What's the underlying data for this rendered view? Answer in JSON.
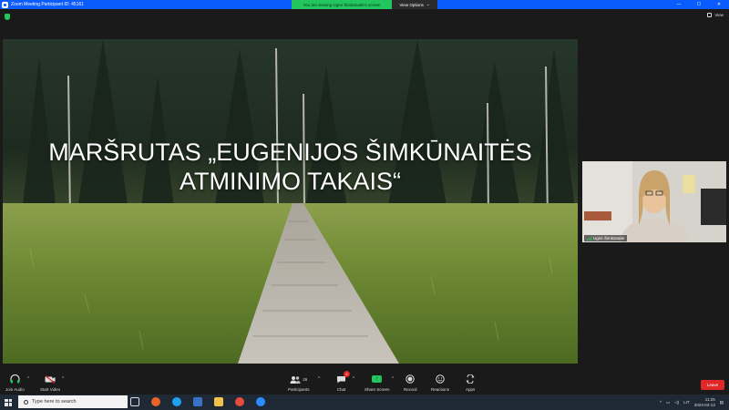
{
  "window": {
    "title": "Zoom Meeting Participant ID: 45161",
    "viewing_banner": "You are viewing Ugnė Šimkūnaitė's screen",
    "view_options": "View Options",
    "controls": [
      "—",
      "☐",
      "✕"
    ]
  },
  "top": {
    "view_label": "View"
  },
  "shared_screen": {
    "slide_title_line1": "MARŠRUTAS „EUGENIJOS ŠIMKŪNAITĖS",
    "slide_title_line2": "ATMINIMO TAKAIS“"
  },
  "participant": {
    "name": "Ugnė Šimkūnaitė"
  },
  "toolbar": {
    "join_audio": "Join Audio",
    "start_video": "Start Video",
    "participants": "Participants",
    "participants_count": "26",
    "chat": "Chat",
    "chat_badge": "2",
    "share_screen": "Share Screen",
    "record": "Record",
    "reactions": "Reactions",
    "apps": "Apps",
    "leave": "Leave"
  },
  "taskbar": {
    "search_placeholder": "Type here to search",
    "tray_lang": "LIT",
    "time": "11:25",
    "date": "2023-03-13"
  },
  "colors": {
    "zoom_blue": "#0b5cff",
    "banner_green": "#22c55e",
    "leave_red": "#e02828",
    "taskbar": "#1f2936"
  }
}
